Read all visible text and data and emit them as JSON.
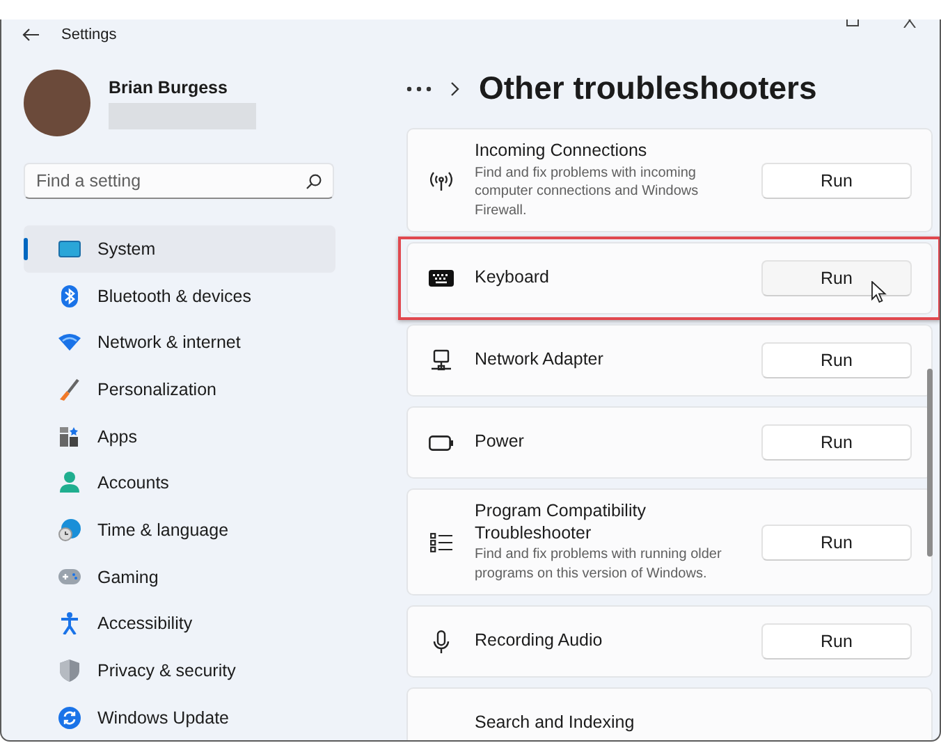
{
  "window": {
    "title": "Settings"
  },
  "profile": {
    "name": "Brian Burgess"
  },
  "search": {
    "placeholder": "Find a setting"
  },
  "nav": [
    {
      "label": "System",
      "selected": true
    },
    {
      "label": "Bluetooth & devices",
      "selected": false
    },
    {
      "label": "Network & internet",
      "selected": false
    },
    {
      "label": "Personalization",
      "selected": false
    },
    {
      "label": "Apps",
      "selected": false
    },
    {
      "label": "Accounts",
      "selected": false
    },
    {
      "label": "Time & language",
      "selected": false
    },
    {
      "label": "Gaming",
      "selected": false
    },
    {
      "label": "Accessibility",
      "selected": false
    },
    {
      "label": "Privacy & security",
      "selected": false
    },
    {
      "label": "Windows Update",
      "selected": false
    }
  ],
  "page_title": "Other troubleshooters",
  "troubleshooters": [
    {
      "title": "Incoming Connections",
      "description": "Find and fix problems with incoming computer connections and Windows Firewall.",
      "button": "Run",
      "highlighted": false,
      "hovered": false
    },
    {
      "title": "Keyboard",
      "button": "Run",
      "highlighted": true,
      "hovered": true
    },
    {
      "title": "Network Adapter",
      "button": "Run",
      "highlighted": false,
      "hovered": false
    },
    {
      "title": "Power",
      "button": "Run",
      "highlighted": false,
      "hovered": false
    },
    {
      "title": "Program Compatibility Troubleshooter",
      "description": "Find and fix problems with running older programs on this version of Windows.",
      "button": "Run",
      "highlighted": false,
      "hovered": false
    },
    {
      "title": "Recording Audio",
      "button": "Run",
      "highlighted": false,
      "hovered": false
    },
    {
      "title": "Search and Indexing",
      "highlighted": false
    }
  ]
}
